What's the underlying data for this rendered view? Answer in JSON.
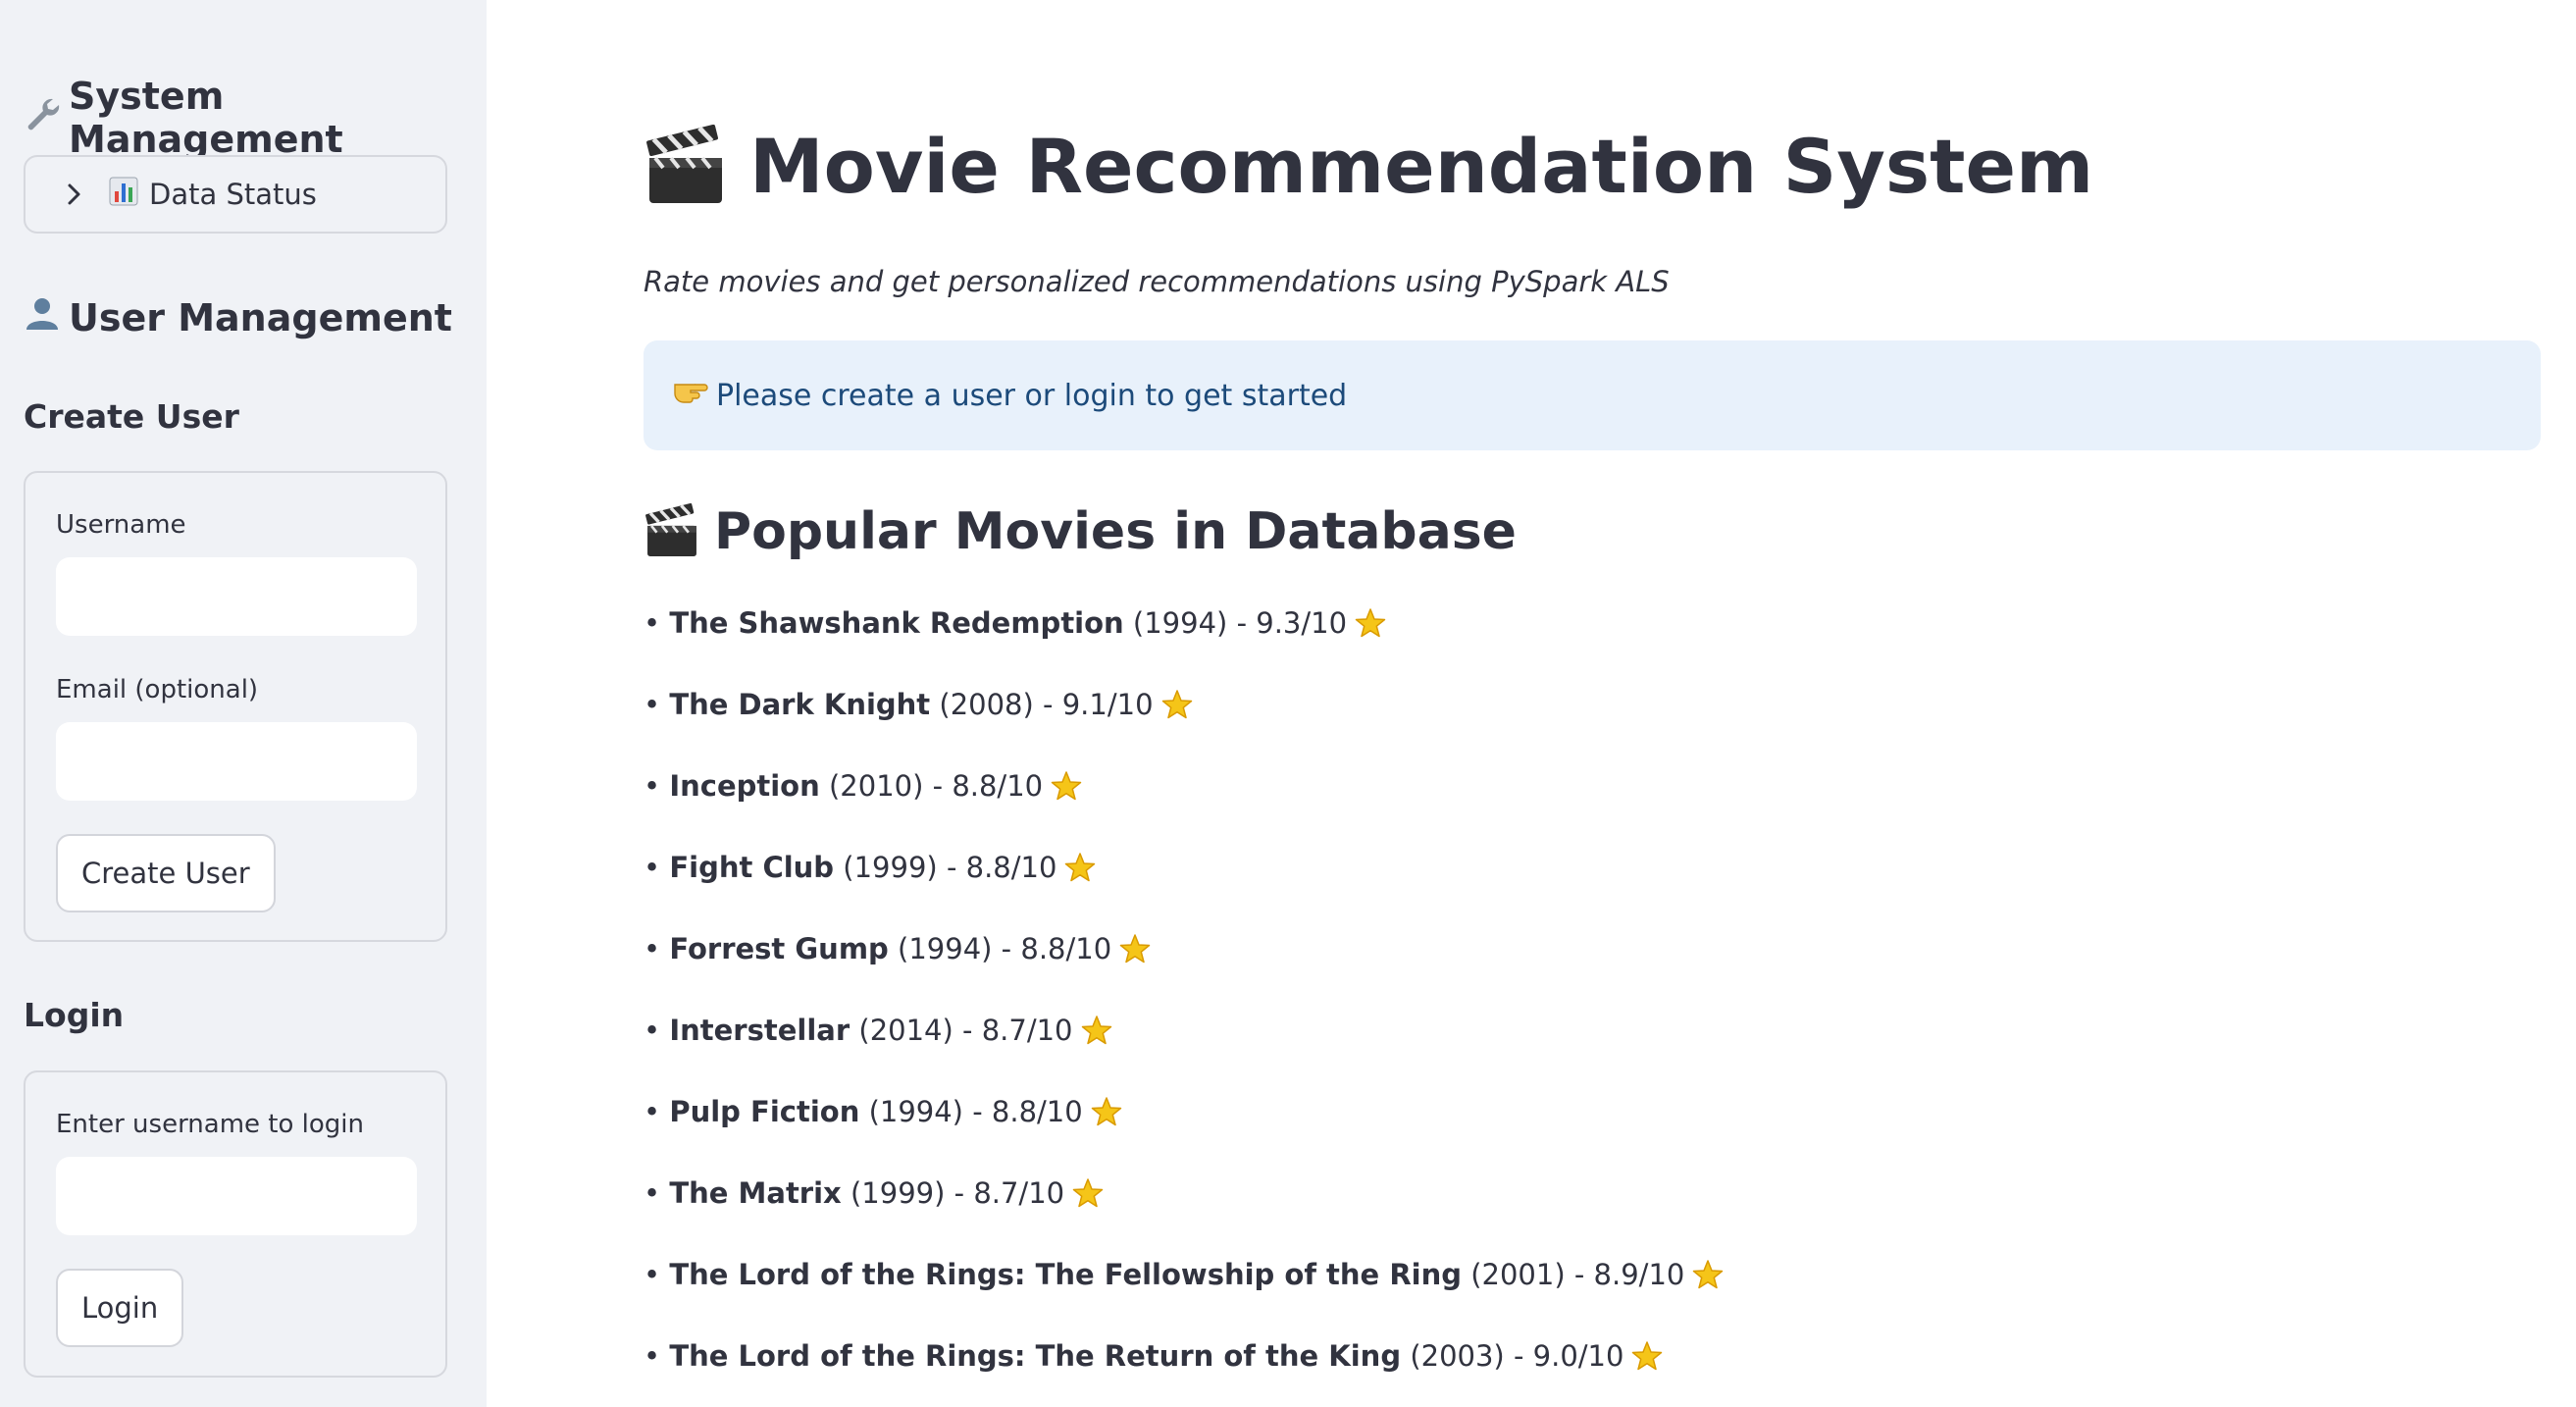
{
  "sidebar": {
    "system_title": "System Management",
    "data_status_label": "Data Status",
    "user_title": "User Management",
    "create_user": {
      "heading": "Create User",
      "username_label": "Username",
      "username_value": "",
      "email_label": "Email (optional)",
      "email_value": "",
      "button_label": "Create User"
    },
    "login": {
      "heading": "Login",
      "username_label": "Enter username to login",
      "username_value": "",
      "button_label": "Login"
    }
  },
  "main": {
    "title": "Movie Recommendation System",
    "subtitle": "Rate movies and get personalized recommendations using PySpark ALS",
    "info_text": "Please create a user or login to get started",
    "popular_title": "Popular Movies in Database",
    "movies": [
      {
        "title": "The Shawshank Redemption",
        "details": "(1994) - 9.3/10"
      },
      {
        "title": "The Dark Knight",
        "details": "(2008) - 9.1/10"
      },
      {
        "title": "Inception",
        "details": "(2010) - 8.8/10"
      },
      {
        "title": "Fight Club",
        "details": "(1999) - 8.8/10"
      },
      {
        "title": "Forrest Gump",
        "details": "(1994) - 8.8/10"
      },
      {
        "title": "Interstellar",
        "details": "(2014) - 8.7/10"
      },
      {
        "title": "Pulp Fiction",
        "details": "(1994) - 8.8/10"
      },
      {
        "title": "The Matrix",
        "details": "(1999) - 8.7/10"
      },
      {
        "title": "The Lord of the Rings: The Fellowship of the Ring",
        "details": "(2001) - 8.9/10"
      },
      {
        "title": "The Lord of the Rings: The Return of the King",
        "details": "(2003) - 9.0/10"
      }
    ]
  },
  "icons": {
    "system": "wrench-icon",
    "data_status": "bar-chart-icon",
    "expander": "chevron-right-icon",
    "user": "user-silhouette-icon",
    "title": "clapperboard-icon",
    "info": "pointing-hand-icon",
    "rating": "star-icon"
  },
  "colors": {
    "sidebar_bg": "#f0f2f6",
    "info_bg": "#e8f1fb",
    "info_text": "#1c4a7a",
    "text": "#31333f",
    "star": "#f5c518"
  }
}
